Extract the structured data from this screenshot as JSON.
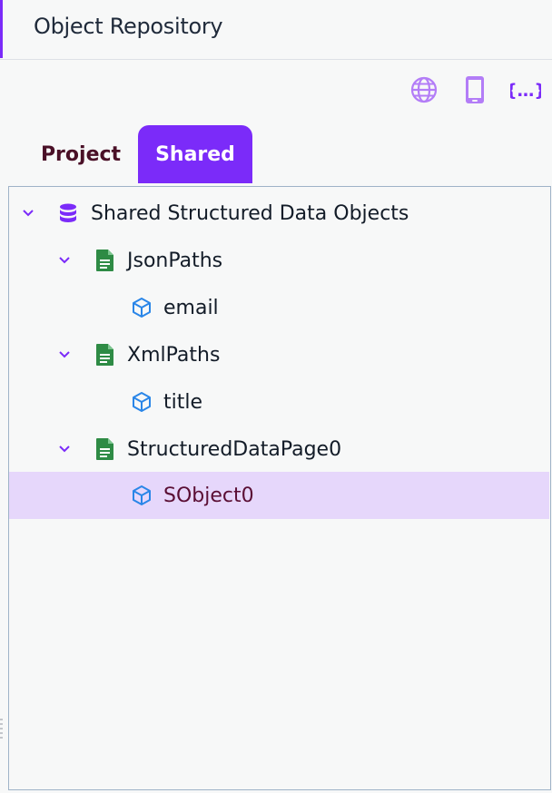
{
  "header": {
    "title": "Object Repository"
  },
  "toolbar": {
    "icons": [
      {
        "name": "globe-icon",
        "color": "#b37df7"
      },
      {
        "name": "mobile-icon",
        "color": "#b37df7"
      },
      {
        "name": "json-braces-icon",
        "color": "#7b2bf9",
        "text": "{…}"
      }
    ]
  },
  "tabs": [
    {
      "label": "Project",
      "active": false
    },
    {
      "label": "Shared",
      "active": true
    }
  ],
  "tree": {
    "root": {
      "label": "Shared Structured Data Objects",
      "icon": "database-icon",
      "expanded": true
    },
    "pages": [
      {
        "label": "JsonPaths",
        "icon": "document-icon",
        "expanded": true,
        "children": [
          {
            "label": "email",
            "icon": "cube-icon",
            "selected": false
          }
        ]
      },
      {
        "label": "XmlPaths",
        "icon": "document-icon",
        "expanded": true,
        "children": [
          {
            "label": "title",
            "icon": "cube-icon",
            "selected": false
          }
        ]
      },
      {
        "label": "StructuredDataPage0",
        "icon": "document-icon",
        "expanded": true,
        "children": [
          {
            "label": "SObject0",
            "icon": "cube-icon",
            "selected": true
          }
        ]
      }
    ]
  },
  "colors": {
    "accent": "#7b2bf9",
    "database": "#7b2bf9",
    "document": "#2e8b45",
    "cube": "#2a86e8",
    "selected_bg": "#e6d7fb"
  }
}
